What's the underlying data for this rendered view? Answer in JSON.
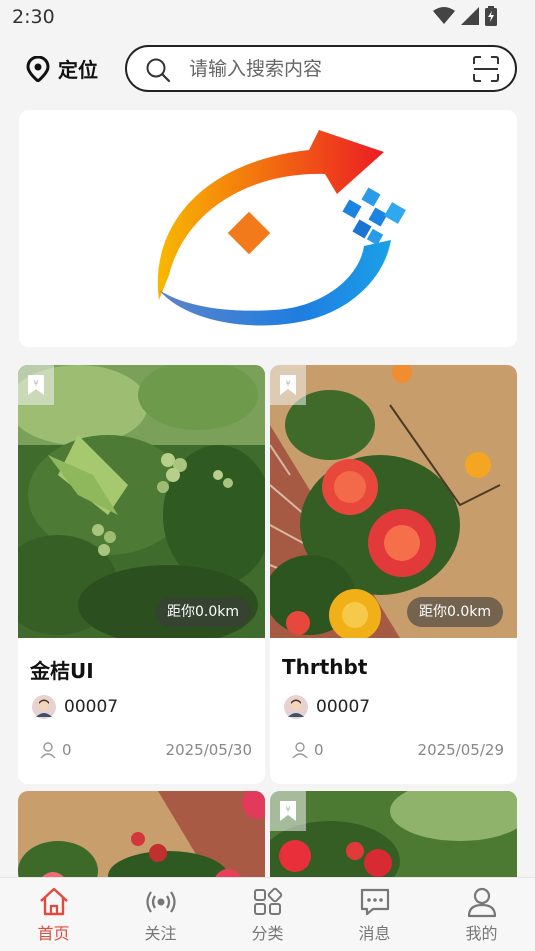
{
  "status_bar": {
    "time": "2:30"
  },
  "header": {
    "location_label": "定位",
    "search_placeholder": "请输入搜索内容"
  },
  "cards": [
    {
      "title": "金桔UI",
      "author": "00007",
      "distance": "距你0.0km",
      "likes": "0",
      "date": "2025/05/30"
    },
    {
      "title": "Thrthbt",
      "author": "00007",
      "distance": "距你0.0km",
      "likes": "0",
      "date": "2025/05/29"
    }
  ],
  "tabs": [
    {
      "label": "首页",
      "icon": "home-icon",
      "active": true
    },
    {
      "label": "关注",
      "icon": "broadcast-icon",
      "active": false
    },
    {
      "label": "分类",
      "icon": "category-icon",
      "active": false
    },
    {
      "label": "消息",
      "icon": "message-icon",
      "active": false
    },
    {
      "label": "我的",
      "icon": "user-icon",
      "active": false
    }
  ],
  "colors": {
    "accent": "#e14a3c",
    "bg": "#f4f4f4",
    "text": "#222222"
  }
}
